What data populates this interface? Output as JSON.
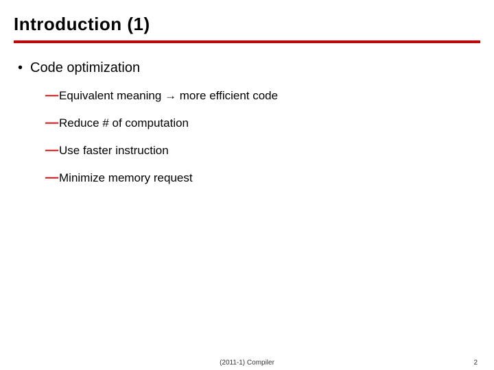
{
  "title": "Introduction (1)",
  "bullets": {
    "l1": "Code optimization",
    "l2": [
      {
        "pre": "Equivalent meaning ",
        "arrow": "→",
        "post": " more efficient code"
      },
      {
        "pre": "Reduce # of computation",
        "arrow": "",
        "post": ""
      },
      {
        "pre": "Use faster instruction",
        "arrow": "",
        "post": ""
      },
      {
        "pre": "Minimize memory request",
        "arrow": "",
        "post": ""
      }
    ]
  },
  "footer": {
    "center": "(2011-1) Compiler",
    "page": "2"
  },
  "glyphs": {
    "bullet": "•",
    "dash": "—"
  }
}
